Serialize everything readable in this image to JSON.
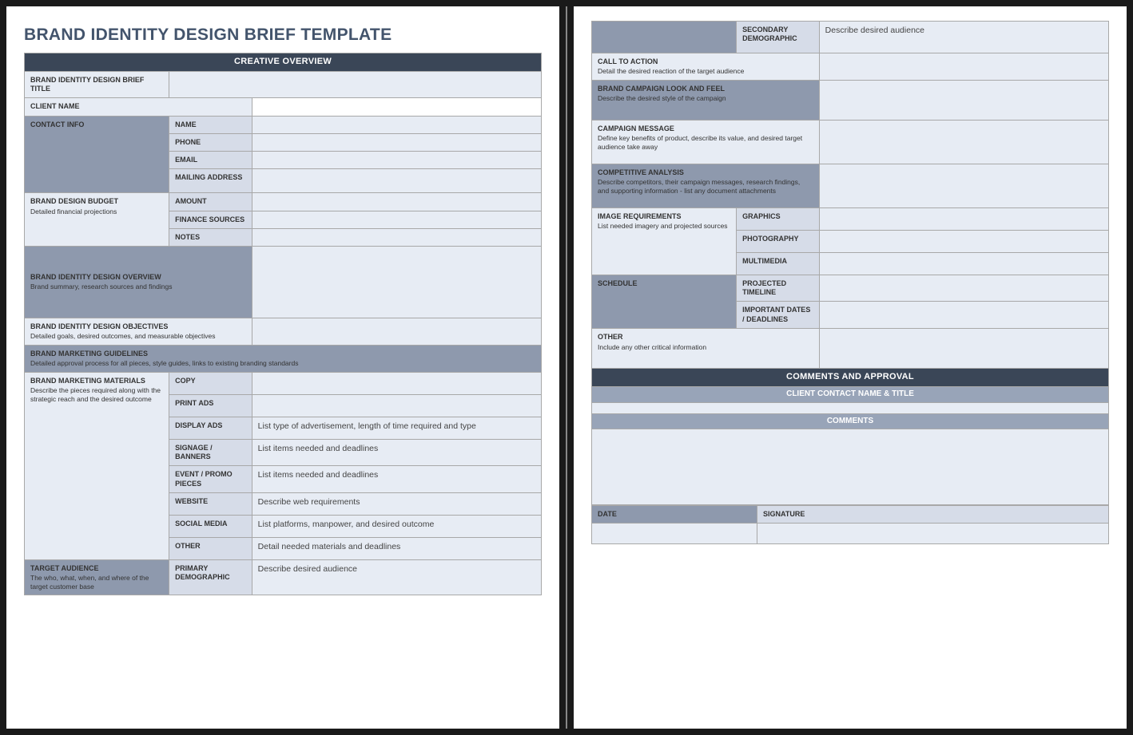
{
  "title": "BRAND IDENTITY DESIGN BRIEF TEMPLATE",
  "sections": {
    "creative_overview": "CREATIVE OVERVIEW",
    "comments_approval": "COMMENTS AND APPROVAL",
    "client_contact_bar": "CLIENT CONTACT NAME & TITLE",
    "comments_bar": "COMMENTS"
  },
  "labels": {
    "brief_title": "BRAND IDENTITY DESIGN BRIEF TITLE",
    "client_name": "CLIENT NAME",
    "contact_info": "CONTACT INFO",
    "name": "NAME",
    "phone": "PHONE",
    "email": "EMAIL",
    "mailing": "MAILING ADDRESS",
    "budget": "BRAND DESIGN BUDGET",
    "budget_sub": "Detailed financial projections",
    "amount": "AMOUNT",
    "fin_sources": "FINANCE SOURCES",
    "notes": "NOTES",
    "overview": "BRAND IDENTITY DESIGN OVERVIEW",
    "overview_sub": "Brand summary, research sources and findings",
    "objectives": "BRAND IDENTITY DESIGN OBJECTIVES",
    "objectives_sub": "Detailed goals, desired outcomes, and measurable objectives",
    "guidelines": "BRAND MARKETING GUIDELINES",
    "guidelines_sub": "Detailed approval process for all pieces, style guides, links to existing branding standards",
    "materials": "BRAND MARKETING MATERIALS",
    "materials_sub": "Describe the pieces required along with the strategic reach and the desired outcome",
    "copy": "COPY",
    "print_ads": "PRINT ADS",
    "display_ads": "DISPLAY ADS",
    "signage": "SIGNAGE / BANNERS",
    "event": "EVENT / PROMO PIECES",
    "website": "WEBSITE",
    "social": "SOCIAL MEDIA",
    "other_mat": "OTHER",
    "target": "TARGET AUDIENCE",
    "target_sub": "The who, what, when, and where of the target customer base",
    "primary_demo": "PRIMARY DEMOGRAPHIC",
    "secondary_demo": "SECONDARY DEMOGRAPHIC",
    "cta": "CALL TO ACTION",
    "cta_sub": "Detail the desired reaction of the target audience",
    "look_feel": "BRAND CAMPAIGN LOOK AND FEEL",
    "look_feel_sub": "Describe the desired style of the campaign",
    "campaign_msg": "CAMPAIGN MESSAGE",
    "campaign_msg_sub": "Define key benefits of product, describe its value, and desired target audience take away",
    "competitive": "COMPETITIVE ANALYSIS",
    "competitive_sub": "Describe competitors, their campaign messages, research findings, and supporting information - list any document attachments",
    "image_req": "IMAGE REQUIREMENTS",
    "image_req_sub": "List needed imagery and projected sources",
    "graphics": "GRAPHICS",
    "photography": "PHOTOGRAPHY",
    "multimedia": "MULTIMEDIA",
    "schedule": "SCHEDULE",
    "timeline": "PROJECTED TIMELINE",
    "deadlines": "IMPORTANT DATES / DEADLINES",
    "other": "OTHER",
    "other_sub": "Include any other critical information",
    "date": "DATE",
    "signature": "SIGNATURE"
  },
  "values": {
    "display_ads": "List type of advertisement, length of time required and type",
    "signage": "List items needed and deadlines",
    "event": "List items needed and deadlines",
    "website": "Describe web requirements",
    "social": "List platforms, manpower, and desired outcome",
    "other_mat": "Detail needed materials and deadlines",
    "primary_demo": "Describe desired audience",
    "secondary_demo": "Describe desired audience"
  }
}
